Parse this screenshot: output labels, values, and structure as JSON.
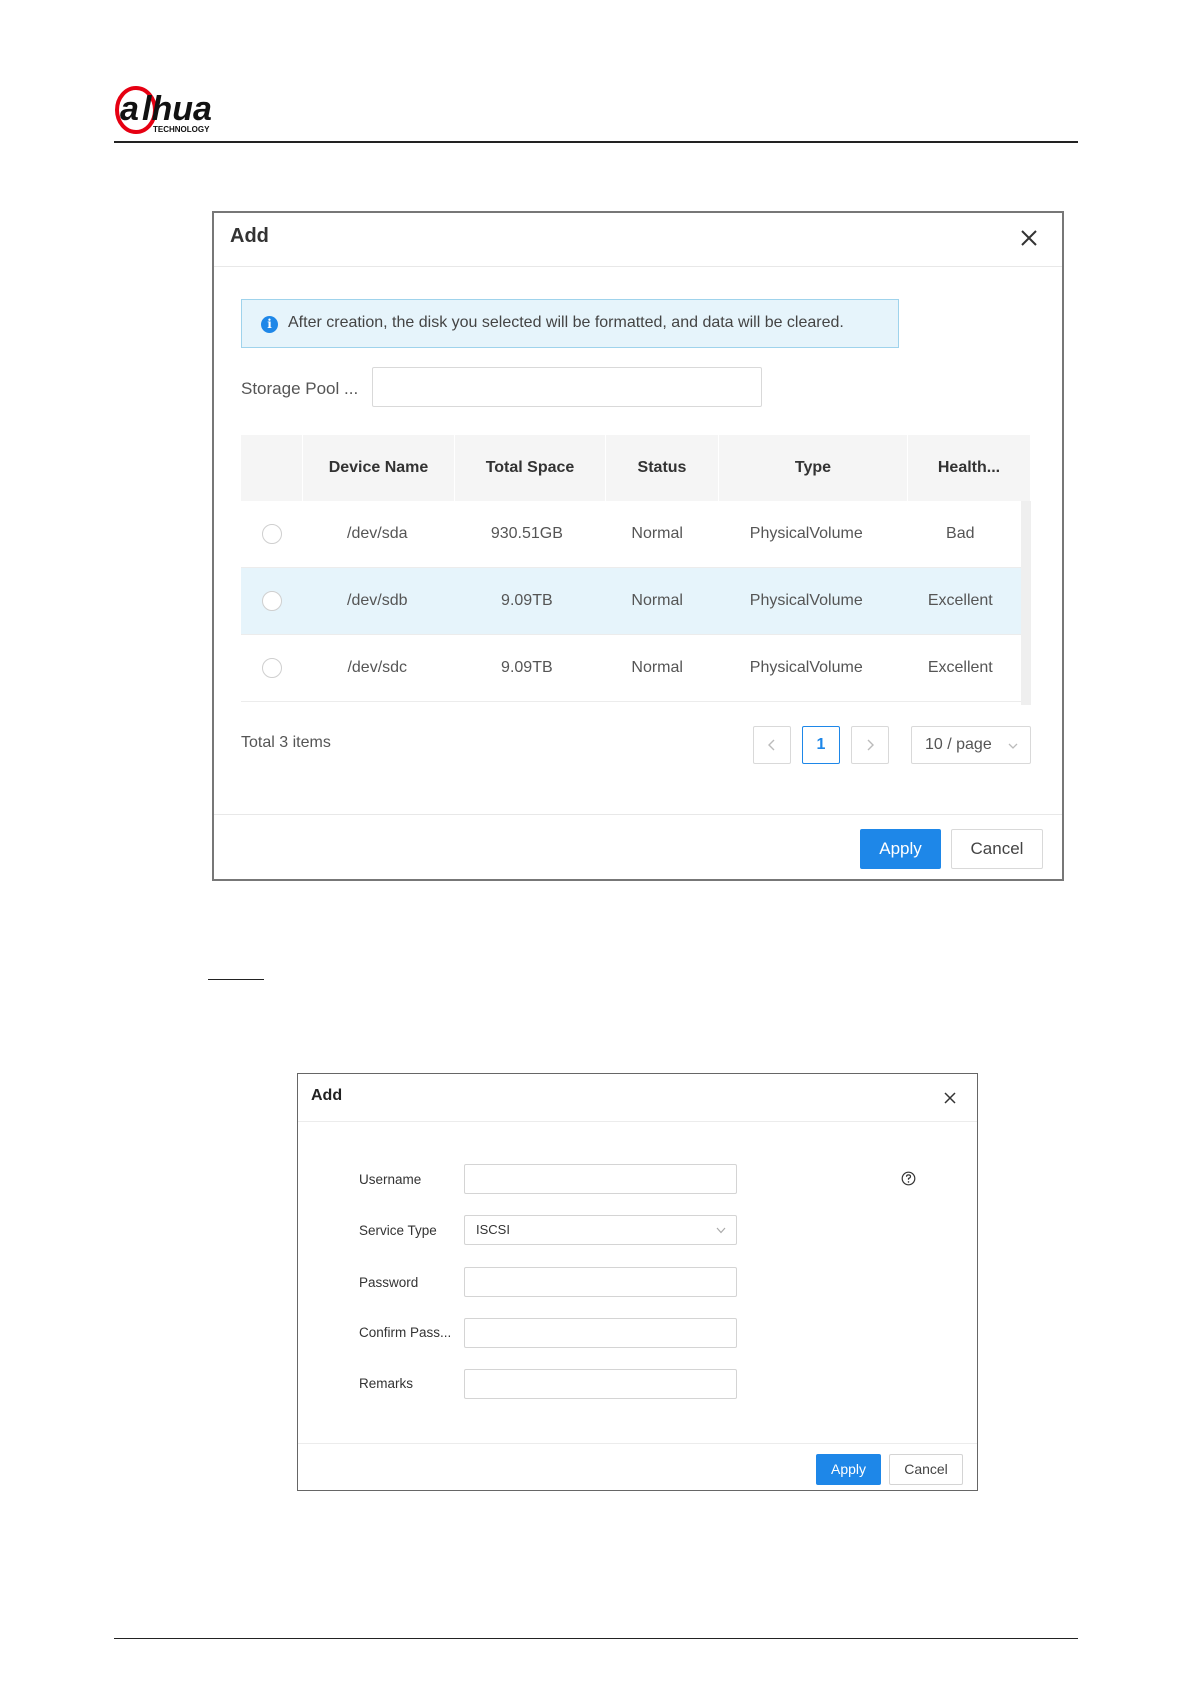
{
  "brand": {
    "logo_text": "alhua",
    "logo_subtext": "TECHNOLOGY",
    "accent_color": "#e60012"
  },
  "dialog1": {
    "title": "Add",
    "alert_text": "After creation, the disk you selected will be formatted, and data will be cleared.",
    "storage_pool_label": "Storage Pool ...",
    "storage_pool_value": "",
    "columns": [
      "Device Name",
      "Total Space",
      "Status",
      "Type",
      "Health..."
    ],
    "rows": [
      {
        "device": "/dev/sda",
        "total": "930.51GB",
        "status": "Normal",
        "type": "PhysicalVolume",
        "health": "Bad"
      },
      {
        "device": "/dev/sdb",
        "total": "9.09TB",
        "status": "Normal",
        "type": "PhysicalVolume",
        "health": "Excellent"
      },
      {
        "device": "/dev/sdc",
        "total": "9.09TB",
        "status": "Normal",
        "type": "PhysicalVolume",
        "health": "Excellent"
      }
    ],
    "total_text": "Total 3 items",
    "current_page": "1",
    "page_size": "10 / page",
    "apply_label": "Apply",
    "cancel_label": "Cancel",
    "primary_color": "#1e87e8"
  },
  "dialog2": {
    "title": "Add",
    "fields": {
      "username_label": "Username",
      "username_value": "",
      "service_type_label": "Service Type",
      "service_type_value": "ISCSI",
      "password_label": "Password",
      "password_value": "",
      "confirm_label": "Confirm Pass...",
      "confirm_value": "",
      "remarks_label": "Remarks",
      "remarks_value": ""
    },
    "apply_label": "Apply",
    "cancel_label": "Cancel"
  }
}
